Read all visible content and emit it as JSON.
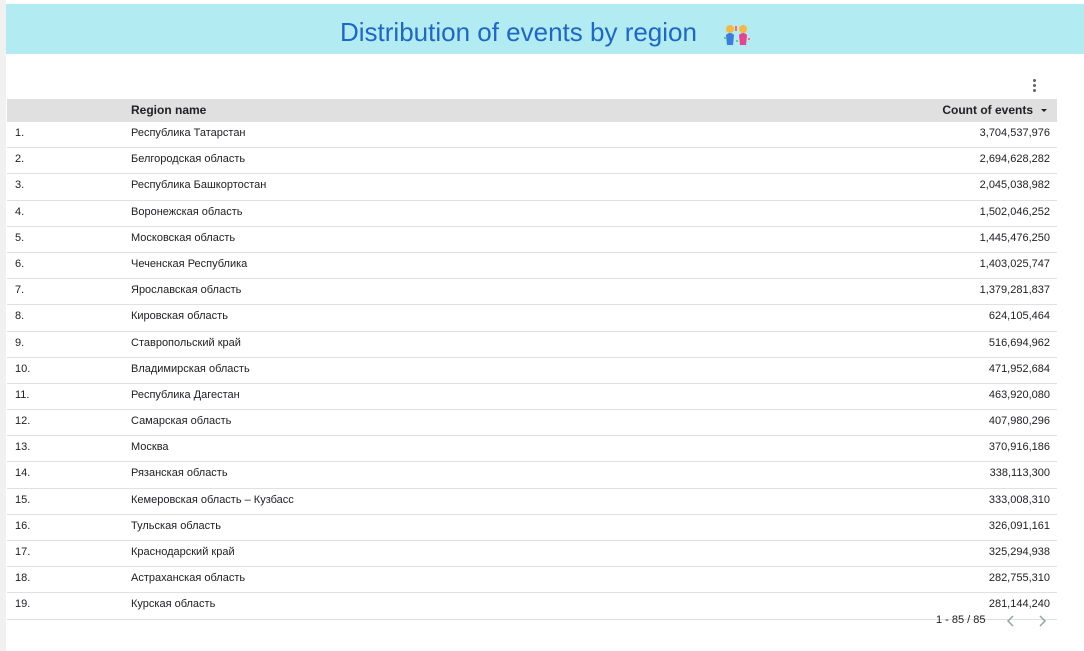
{
  "header": {
    "title": "Distribution of events by region",
    "icon": "celebration-couple-icon"
  },
  "table": {
    "columns": {
      "name": "Region name",
      "count": "Count of events"
    },
    "rows": [
      {
        "num": "1.",
        "name": "Республика Татарстан",
        "count": "3,704,537,976"
      },
      {
        "num": "2.",
        "name": "Белгородская область",
        "count": "2,694,628,282"
      },
      {
        "num": "3.",
        "name": "Республика Башкортостан",
        "count": "2,045,038,982"
      },
      {
        "num": "4.",
        "name": "Воронежская область",
        "count": "1,502,046,252"
      },
      {
        "num": "5.",
        "name": "Московская область",
        "count": "1,445,476,250"
      },
      {
        "num": "6.",
        "name": "Чеченская Республика",
        "count": "1,403,025,747"
      },
      {
        "num": "7.",
        "name": "Ярославская область",
        "count": "1,379,281,837"
      },
      {
        "num": "8.",
        "name": "Кировская область",
        "count": "624,105,464"
      },
      {
        "num": "9.",
        "name": "Ставропольский край",
        "count": "516,694,962"
      },
      {
        "num": "10.",
        "name": "Владимирская область",
        "count": "471,952,684"
      },
      {
        "num": "11.",
        "name": "Республика Дагестан",
        "count": "463,920,080"
      },
      {
        "num": "12.",
        "name": "Самарская область",
        "count": "407,980,296"
      },
      {
        "num": "13.",
        "name": "Москва",
        "count": "370,916,186"
      },
      {
        "num": "14.",
        "name": "Рязанская область",
        "count": "338,113,300"
      },
      {
        "num": "15.",
        "name": "Кемеровская область – Кузбасс",
        "count": "333,008,310"
      },
      {
        "num": "16.",
        "name": "Тульская область",
        "count": "326,091,161"
      },
      {
        "num": "17.",
        "name": "Краснодарский край",
        "count": "325,294,938"
      },
      {
        "num": "18.",
        "name": "Астраханская область",
        "count": "282,755,310"
      },
      {
        "num": "19.",
        "name": "Курская область",
        "count": "281,144,240"
      }
    ]
  },
  "pagination": {
    "label": "1 - 85 / 85"
  },
  "colors": {
    "banner_bg": "#b3ebf2",
    "title_color": "#1d68c7",
    "header_bg": "#e0e0e0"
  }
}
